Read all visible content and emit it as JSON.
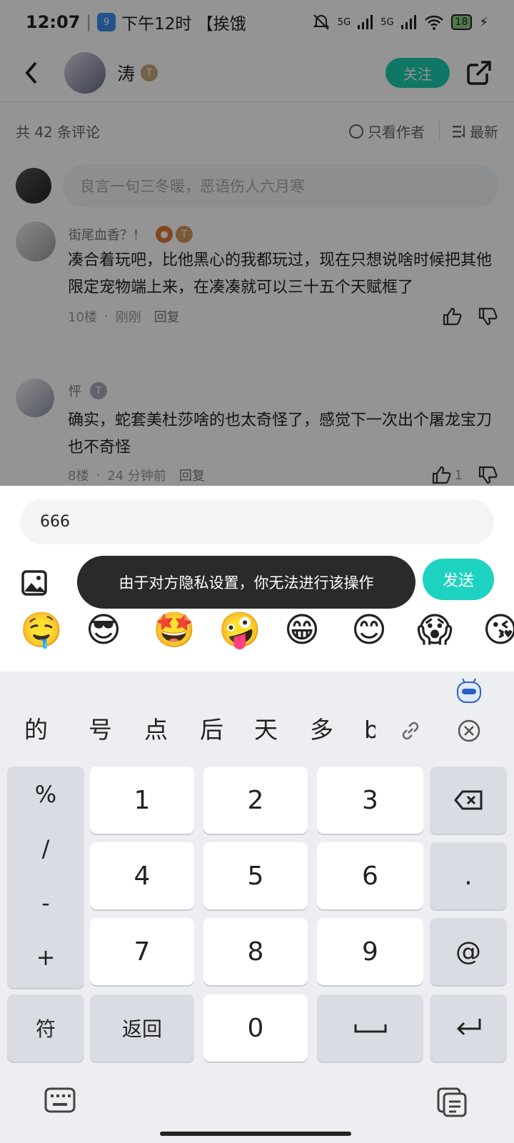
{
  "status": {
    "time": "12:07",
    "app_text": "下午12时 【挨饿",
    "battery": "18",
    "net1": "5G",
    "net2": "5G",
    "app_badge": "9"
  },
  "header": {
    "author": "涛",
    "follow": "关注"
  },
  "comments_header": {
    "count": "共 42 条评论",
    "only_author": "只看作者",
    "sort": "最新"
  },
  "comment_input": {
    "placeholder": "良言一句三冬暖，恶语伤人六月寒"
  },
  "comments": [
    {
      "user": "街尾血香？！",
      "text": "凑合着玩吧，比他黑心的我都玩过，现在只想说啥时候把其他限定宠物端上来，在凑凑就可以三十五个天赋框了",
      "floor": "10楼",
      "time": "刚刚",
      "reply": "回复",
      "likes": ""
    },
    {
      "user": "怦",
      "text": "确实，蛇套美杜莎啥的也太奇怪了，感觉下一次出个屠龙宝刀也不奇怪",
      "floor": "8楼",
      "time": "24 分钟前",
      "reply": "回复",
      "likes": "1"
    }
  ],
  "reply": {
    "value": "666",
    "send": "发送"
  },
  "toast": "由于对方隐私设置，你无法进行该操作",
  "emojis": [
    "🤤",
    "😎",
    "🤩",
    "🤪",
    "😁",
    "😊",
    "😱",
    "😘"
  ],
  "keyboard": {
    "candidates": [
      "的",
      "号",
      "点",
      "后",
      "天",
      "多",
      "b"
    ],
    "symbols": [
      "%",
      "/",
      "-",
      "+"
    ],
    "digits": [
      "1",
      "2",
      "3",
      "4",
      "5",
      "6",
      "7",
      "8",
      "9",
      "0"
    ],
    "dot": ".",
    "at": "@",
    "fu": "符",
    "back": "返回"
  },
  "colors": {
    "accent": "#1dcbb0",
    "toast": "#2a2a2a"
  }
}
